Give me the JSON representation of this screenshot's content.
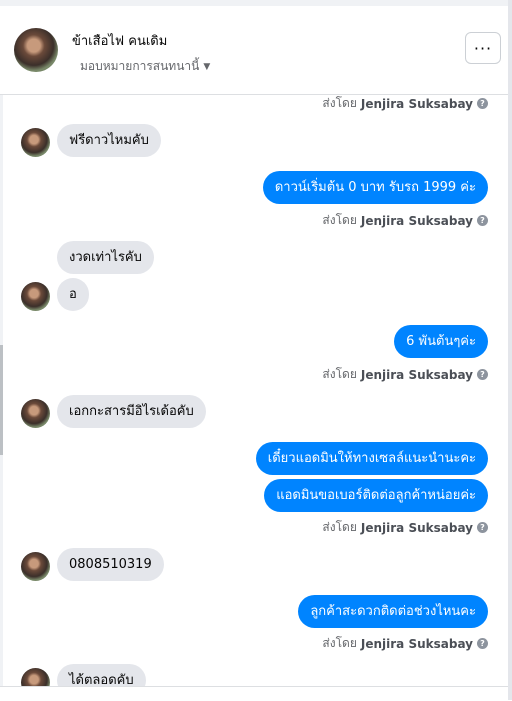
{
  "colors": {
    "accent": "#0084ff",
    "incoming_bubble": "#e4e6eb",
    "muted_text": "#65676b"
  },
  "header": {
    "name": "ข้าเสือไฟ คนเดิม",
    "assign_label": "มอบหมายการสนทนานี้",
    "more_label": "···"
  },
  "sent_by": {
    "prefix": "ส่งโดย",
    "name": "Jenjira Suksabay"
  },
  "messages": [
    {
      "side": "in",
      "text": "ฟรีดาวไหมคับ"
    },
    {
      "side": "out",
      "text": "ดาวน์เริ่มต้น 0 บาท รับรถ 1999 ค่ะ"
    },
    {
      "side": "in",
      "text": "งวดเท่าไรคับ"
    },
    {
      "side": "in",
      "text": "อ"
    },
    {
      "side": "out",
      "text": "6 พันต้นๆค่ะ"
    },
    {
      "side": "in",
      "text": "เอกกะสารมีอิไรเด้อคับ"
    },
    {
      "side": "out",
      "text": "เดี๋ยวแอดมินให้ทางเซลล์แนะนำนะคะ"
    },
    {
      "side": "out",
      "text": "แอดมินขอเบอร์ติดต่อลูกค้าหน่อยค่ะ"
    },
    {
      "side": "in",
      "text": "0808510319"
    },
    {
      "side": "out",
      "text": "ลูกค้าสะดวกติดต่อช่วงไหนคะ"
    },
    {
      "side": "in",
      "text": "ได้ตลอดคับ"
    }
  ]
}
